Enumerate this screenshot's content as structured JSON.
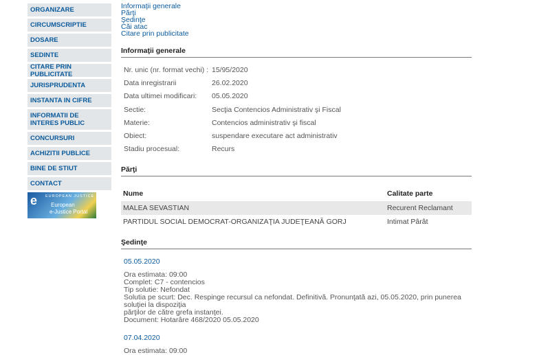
{
  "sidebar": {
    "items": [
      {
        "label": "ORGANIZARE"
      },
      {
        "label": "CIRCUMSCRIPTIE"
      },
      {
        "label": "DOSARE"
      },
      {
        "label": "SEDINTE"
      },
      {
        "label": "CITARE PRIN PUBLICITATE"
      },
      {
        "label": "JURISPRUDENTA"
      },
      {
        "label": "INSTANTA IN CIFRE"
      },
      {
        "label": "INFORMATII DE INTERES PUBLIC"
      },
      {
        "label": "CONCURSURI"
      },
      {
        "label": "ACHIZITII PUBLICE"
      },
      {
        "label": "BINE DE STIUT"
      },
      {
        "label": "CONTACT"
      }
    ],
    "ejustice": {
      "top": "EUROPEAN JUSTICE",
      "title": "European",
      "sub": "e-Justice Portal",
      "logo_letter": "e"
    }
  },
  "anchors": [
    "Informaţii generale",
    "Părţi",
    "Şedinţe",
    "Căi atac",
    "Citare prin publicitate"
  ],
  "info": {
    "title": "Informaţii generale",
    "rows": [
      {
        "label": "Nr. unic (nr. format vechi) :",
        "value": "15/95/2020"
      },
      {
        "label": "Data inregistrarii",
        "value": "26.02.2020"
      },
      {
        "label": "Data ultimei modificari:",
        "value": "05.05.2020"
      },
      {
        "label": "Sectie:",
        "value": "Secţia Contencios Administrativ şi Fiscal"
      },
      {
        "label": "Materie:",
        "value": "Contencios administrativ şi fiscal"
      },
      {
        "label": "Obiect:",
        "value": "suspendare executare act administrativ"
      },
      {
        "label": "Stadiu procesual:",
        "value": "Recurs"
      }
    ]
  },
  "parti": {
    "title": "Părţi",
    "headers": {
      "name": "Nume",
      "role": "Calitate parte"
    },
    "rows": [
      {
        "name": "MALEA SEVASTIAN",
        "role": "Recurent Reclamant"
      },
      {
        "name": "PARTIDUL SOCIAL DEMOCRAT-ORGANIZAŢIA JUDEŢEANĂ GORJ",
        "role": "Intimat Pârât"
      }
    ]
  },
  "sedinte": {
    "title": "Şedinţe",
    "items": [
      {
        "date": "05.05.2020",
        "lines": [
          "Ora estimata: 09:00",
          "Complet: C7 - contencios",
          "Tip solutie: Nefondat",
          "Solutia pe scurt: Dec. Respinge recursul ca nefondat. Definitivă. Pronunţată azi, 05.05.2020, prin punerea soluţiei la dispoziţia",
          "părţilor de către grefa instanţei.",
          "Document: Hotarâre  468/2020  05.05.2020"
        ]
      },
      {
        "date": "07.04.2020",
        "lines": [
          "Ora estimata: 09:00"
        ]
      }
    ]
  }
}
